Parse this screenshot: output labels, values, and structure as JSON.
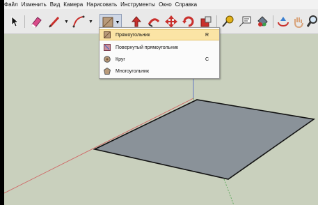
{
  "menubar": {
    "items": [
      {
        "label": "Файл"
      },
      {
        "label": "Изменить"
      },
      {
        "label": "Вид"
      },
      {
        "label": "Камера"
      },
      {
        "label": "Нарисовать"
      },
      {
        "label": "Инструменты"
      },
      {
        "label": "Окно"
      },
      {
        "label": "Справка"
      }
    ]
  },
  "toolbar": {
    "tools": [
      {
        "name": "select-icon"
      },
      {
        "name": "eraser-icon"
      },
      {
        "name": "pencil-icon"
      },
      {
        "name": "arc-icon"
      },
      {
        "name": "rectangle-icon",
        "active": true
      },
      {
        "name": "push-pull-icon"
      },
      {
        "name": "follow-me-icon"
      },
      {
        "name": "move-icon"
      },
      {
        "name": "rotate-icon"
      },
      {
        "name": "scale-icon"
      },
      {
        "name": "tape-measure-icon"
      },
      {
        "name": "text-icon"
      },
      {
        "name": "paint-bucket-icon"
      },
      {
        "name": "orbit-icon"
      },
      {
        "name": "pan-icon"
      },
      {
        "name": "zoom-icon"
      }
    ],
    "dropdown_arrow": "▼"
  },
  "shape_menu": {
    "items": [
      {
        "label": "Прямоугольник",
        "shortcut": "R",
        "icon": "rectangle-icon",
        "selected": true
      },
      {
        "label": "Повернутый прямоугольник",
        "shortcut": "",
        "icon": "rotated-rectangle-icon",
        "selected": false
      },
      {
        "label": "Круг",
        "shortcut": "C",
        "icon": "circle-icon",
        "selected": false
      },
      {
        "label": "Многоугольник",
        "shortcut": "",
        "icon": "polygon-icon",
        "selected": false
      }
    ]
  },
  "colors": {
    "viewport_bg": "#c9d0bd",
    "rectangle_fill": "#8a9299",
    "menu_selected": "#fbe4a5",
    "axis_red": "#d06060",
    "axis_green": "#4aa24a",
    "axis_blue": "#4b62c4"
  }
}
